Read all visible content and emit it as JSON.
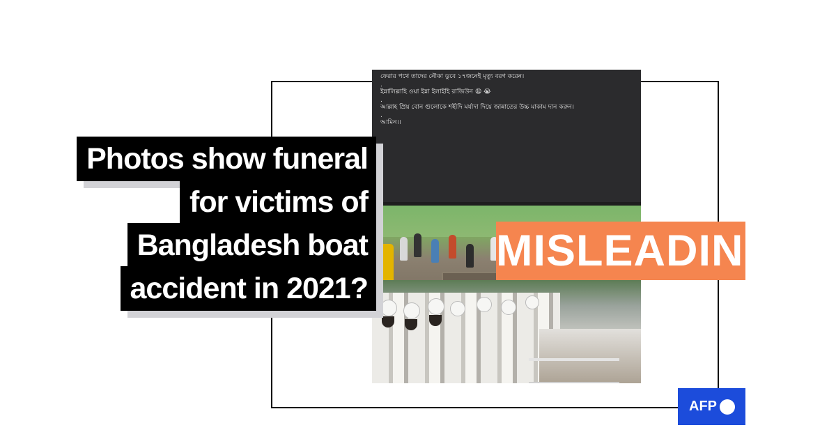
{
  "post": {
    "lines": [
      "ফেরার পথে তাদের নৌকা ডুবে ১৭জনেই মৃত্যু বরণ করেন।",
      ".",
      "ইন্নালিল্লাহি ওয়া ইন্না ইলাইহি রাজিউন 😩 😭",
      ".",
      "আল্লাহ প্রিয় বোন গুলোকে শহীদি মর্যাদা দিয়ে জান্নাতের উচ্চ মাকাম দান করুন।",
      ".",
      "আমিন।।"
    ]
  },
  "headline": {
    "lines": [
      "Photos show funeral",
      "for victims of",
      "Bangladesh boat",
      "accident in 2021?"
    ]
  },
  "verdict": {
    "label": "MISLEADING",
    "color": "#f5854f"
  },
  "logo": {
    "text": "AFP",
    "color": "#1c4cdb"
  }
}
